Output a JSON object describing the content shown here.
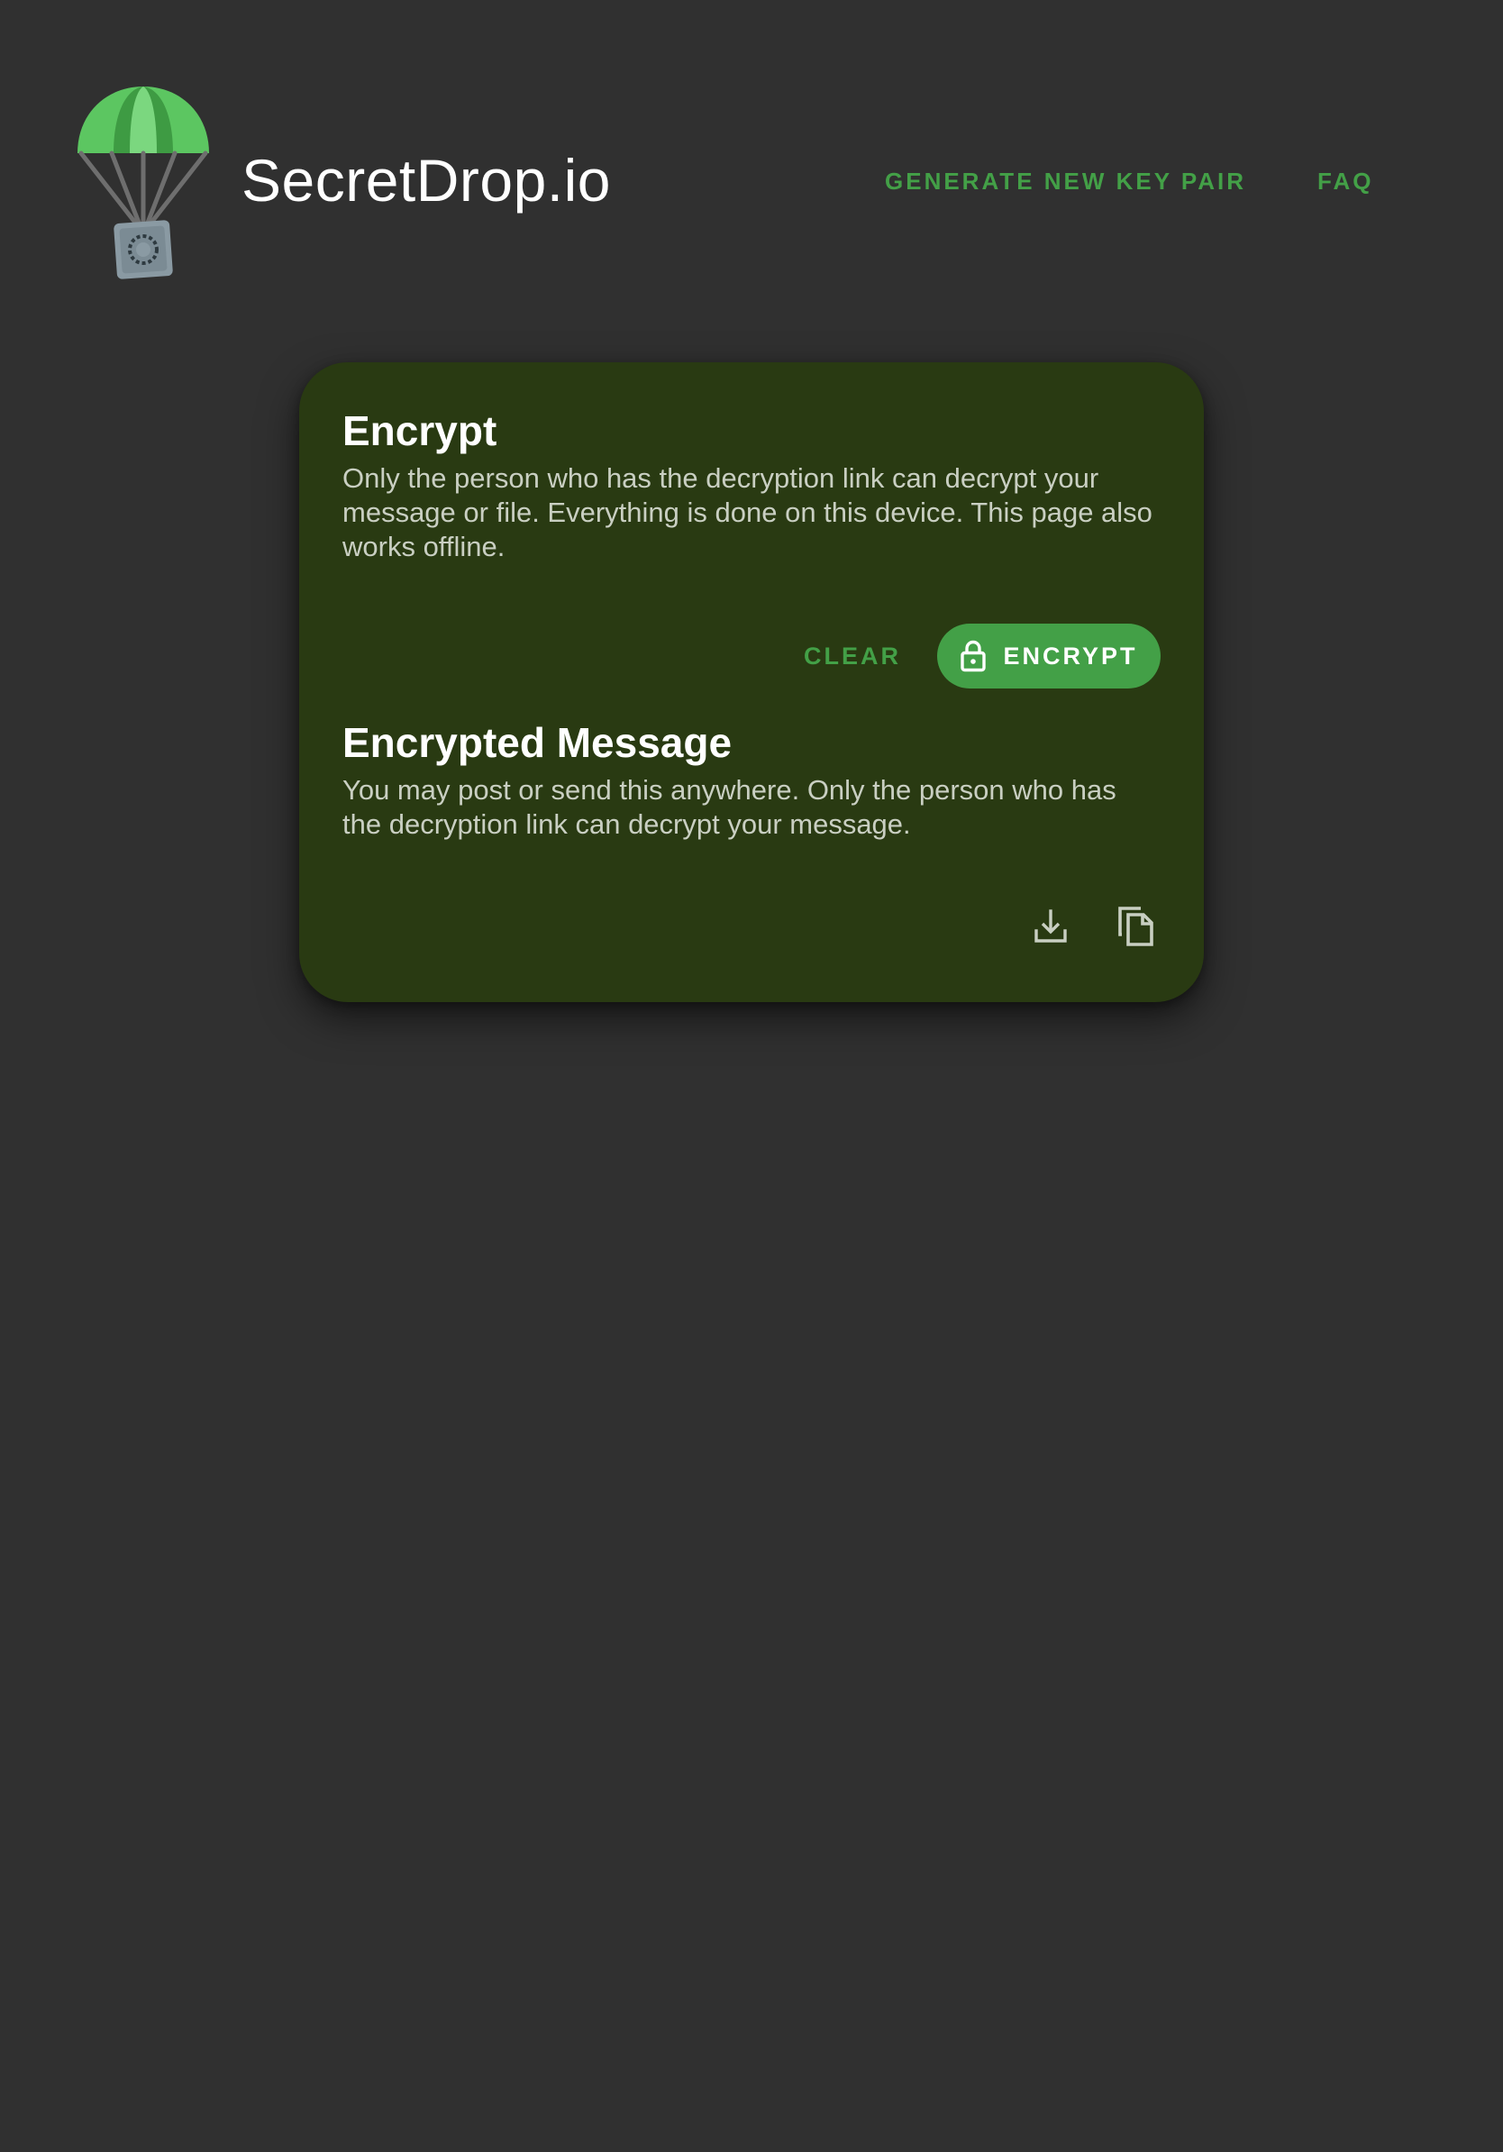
{
  "header": {
    "brand": "SecretDrop.io",
    "nav": {
      "generate_key_pair": "GENERATE NEW KEY PAIR",
      "faq": "FAQ"
    }
  },
  "encrypt": {
    "title": "Encrypt",
    "description": "Only the person who has the decryption link can decrypt your message or file. Everything is done on this device. This page also works offline.",
    "clear_label": "CLEAR",
    "encrypt_label": "ENCRYPT",
    "encrypt_icon": "lock-icon"
  },
  "encrypted_message": {
    "title": "Encrypted Message",
    "description": "You may post or send this anywhere. Only the person who has the decryption link can decrypt your message.",
    "actions": {
      "download_icon": "download-icon",
      "copy_icon": "copy-icon"
    }
  },
  "colors": {
    "background": "#303030",
    "card": "#293a12",
    "accent": "#43a047",
    "text_primary": "#ffffff",
    "text_secondary": "#c9cfc2"
  }
}
